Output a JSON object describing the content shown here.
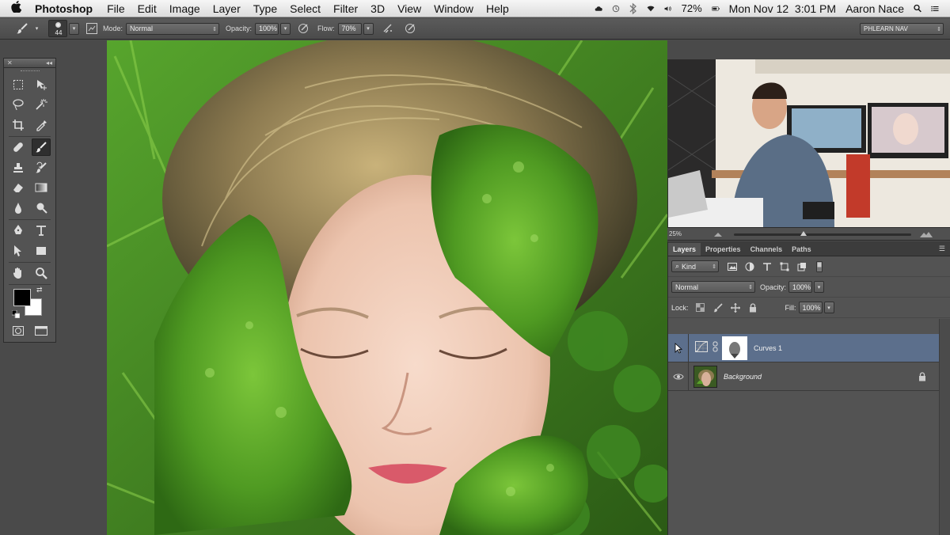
{
  "menubar": {
    "app_name": "Photoshop",
    "menus": [
      "File",
      "Edit",
      "Image",
      "Layer",
      "Type",
      "Select",
      "Filter",
      "3D",
      "View",
      "Window",
      "Help"
    ],
    "battery": "72%",
    "datetime": "Mon Nov 12  3:01 PM",
    "user": "Aaron Nace"
  },
  "options_bar": {
    "brush_size": "44",
    "mode_label": "Mode:",
    "mode_value": "Normal",
    "opacity_label": "Opacity:",
    "opacity_value": "100%",
    "flow_label": "Flow:",
    "flow_value": "70%",
    "workspace": "PHLEARN NAV"
  },
  "navigator": {
    "zoom": "25%"
  },
  "layers_panel": {
    "tabs": [
      "Layers",
      "Properties",
      "Channels",
      "Paths"
    ],
    "filter_kind": "Kind",
    "blend_mode": "Normal",
    "opacity_label": "Opacity:",
    "opacity_value": "100%",
    "lock_label": "Lock:",
    "fill_label": "Fill:",
    "fill_value": "100%",
    "layers": [
      {
        "name": "Curves 1",
        "selected": true
      },
      {
        "name": "Background",
        "selected": false
      }
    ]
  },
  "colors": {
    "foreground": "#000000",
    "background": "#ffffff",
    "selection": "#5c6f8c"
  }
}
